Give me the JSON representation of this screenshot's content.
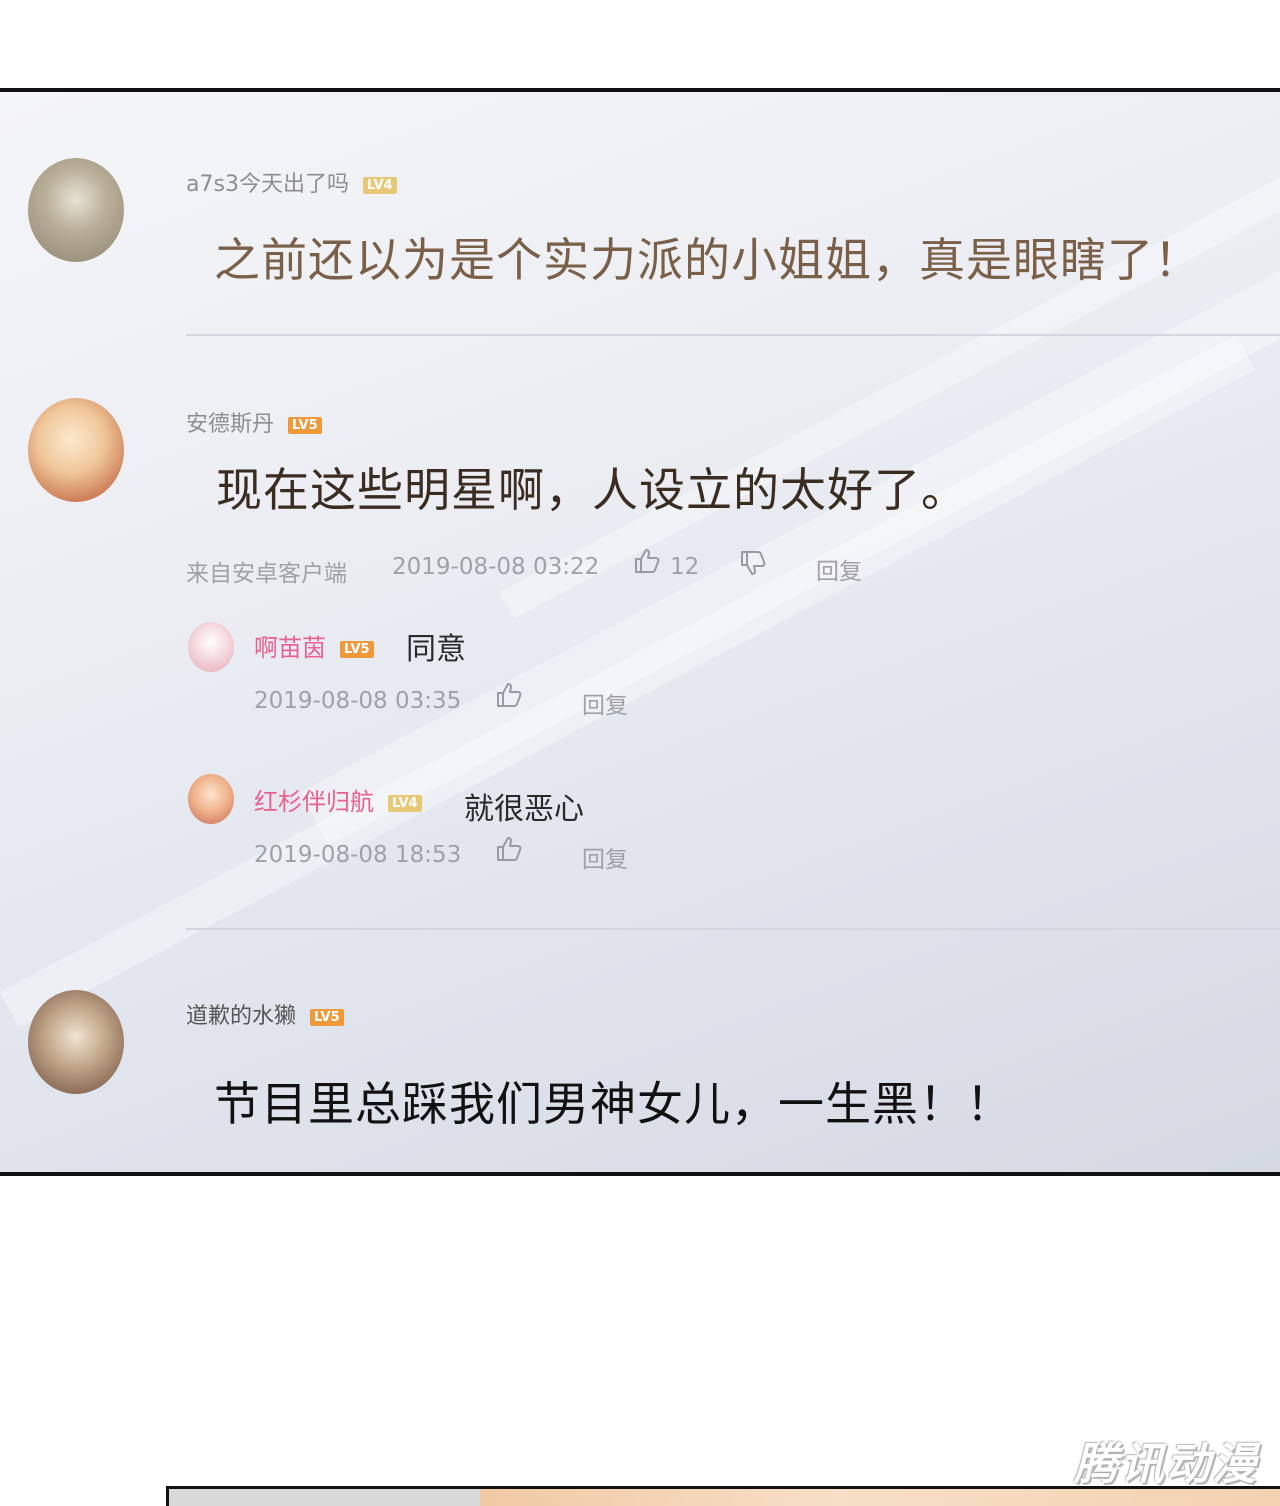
{
  "comments": [
    {
      "username": "a7s3今天出了吗",
      "level": "LV4",
      "level_color": "#e6c877",
      "text": "之前还以为是个实力派的小姐姐，真是眼瞎了！",
      "text_color": "#7a6048"
    },
    {
      "username": "安德斯丹",
      "level": "LV5",
      "level_color": "#ef9a3a",
      "text": "现在这些明星啊，人设立的太好了。",
      "text_color": "#3a2c20",
      "source": "来自安卓客户端",
      "time": "2019-08-08 03:22",
      "likes": "12",
      "reply_label": "回复",
      "replies": [
        {
          "username": "啊苗茵",
          "level": "LV5",
          "level_color": "#ef9a3a",
          "text": "同意",
          "time": "2019-08-08 03:35",
          "reply_label": "回复"
        },
        {
          "username": "红杉伴归航",
          "level": "LV4",
          "level_color": "#e6c877",
          "text": "就很恶心",
          "time": "2019-08-08 18:53",
          "reply_label": "回复"
        }
      ]
    },
    {
      "username": "道歉的水獭",
      "level": "LV5",
      "level_color": "#ef9a3a",
      "text": "节目里总踩我们男神女儿，一生黑！！",
      "text_color": "#111111"
    }
  ],
  "watermark": "腾讯动漫"
}
